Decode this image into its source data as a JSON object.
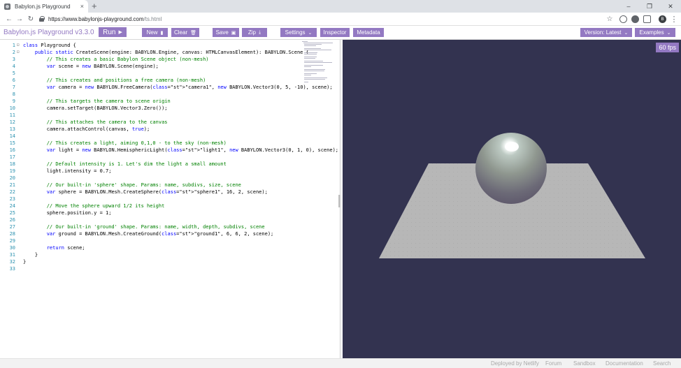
{
  "browser": {
    "tab_title": "Babylon.js Playground",
    "tab_close": "×",
    "new_tab": "+",
    "window_minimize": "–",
    "window_maximize": "❐",
    "window_close": "✕",
    "url_host": "https://www.babylonjs-playground.com",
    "url_path": "/ts.html",
    "back": "←",
    "forward": "→",
    "reload": "↻",
    "bookmark": "☆",
    "profile_initial": "B",
    "menu": "⋮"
  },
  "menubar": {
    "brand": "Babylon.js Playground v3.3.0",
    "run": "Run",
    "run_icon": "▶",
    "new": "New",
    "clear": "Clear",
    "save": "Save",
    "zip": "Zip",
    "settings": "Settings",
    "inspector": "Inspector",
    "metadata": "Metadata",
    "version": "Version: Latest",
    "examples": "Examples",
    "chevron": "⌄",
    "new_icon": "▮",
    "clear_icon": "🗑",
    "save_icon": "▣",
    "zip_icon": "⤓"
  },
  "editor": {
    "lines": [
      "class Playground {",
      "    public static CreateScene(engine: BABYLON.Engine, canvas: HTMLCanvasElement): BABYLON.Scene {",
      "        // This creates a basic Babylon Scene object (non-mesh)",
      "        var scene = new BABYLON.Scene(engine);",
      "",
      "        // This creates and positions a free camera (non-mesh)",
      "        var camera = new BABYLON.FreeCamera(\"camera1\", new BABYLON.Vector3(0, 5, -10), scene);",
      "",
      "        // This targets the camera to scene origin",
      "        camera.setTarget(BABYLON.Vector3.Zero());",
      "",
      "        // This attaches the camera to the canvas",
      "        camera.attachControl(canvas, true);",
      "",
      "        // This creates a light, aiming 0,1,0 - to the sky (non-mesh)",
      "        var light = new BABYLON.HemisphericLight(\"light1\", new BABYLON.Vector3(0, 1, 0), scene);",
      "",
      "        // Default intensity is 1. Let's dim the light a small amount",
      "        light.intensity = 0.7;",
      "",
      "        // Our built-in 'sphere' shape. Params: name, subdivs, size, scene",
      "        var sphere = BABYLON.Mesh.CreateSphere(\"sphere1\", 16, 2, scene);",
      "",
      "        // Move the sphere upward 1/2 its height",
      "        sphere.position.y = 1;",
      "",
      "        // Our built-in 'ground' shape. Params: name, width, depth, subdivs, scene",
      "        var ground = BABYLON.Mesh.CreateGround(\"ground1\", 6, 6, 2, scene);",
      "",
      "        return scene;",
      "    }",
      "}",
      ""
    ]
  },
  "canvas": {
    "fps": "60 fps",
    "background": "#333350",
    "ground_color": "#b7b7b7",
    "sphere_color": "#9a9a9a"
  },
  "footer": {
    "links": [
      "Deployed by Netlify",
      "Forum",
      "Sandbox",
      "Documentation",
      "Search"
    ]
  },
  "colors": {
    "accent": "#9379c2"
  }
}
